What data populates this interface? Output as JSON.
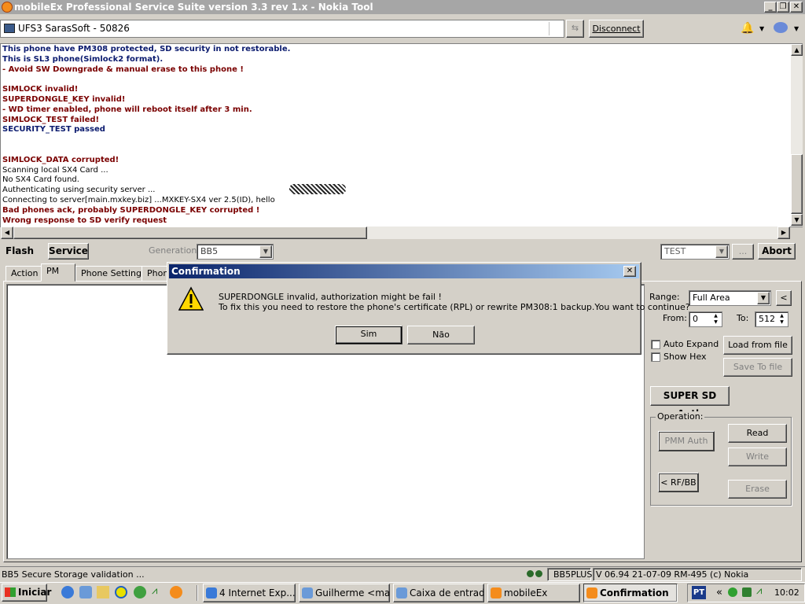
{
  "window": {
    "title": "mobileEx Professional Service Suite version 3.3 rev 1.x  - Nokia Tool",
    "min": "_",
    "max": "❐",
    "close": "✕"
  },
  "toolbar": {
    "device": "UFS3 SarasSoft - 50826",
    "disconnect": "Disconnect"
  },
  "log": [
    {
      "text": "This phone have PM308 protected, SD security in not restorable.",
      "style": "navy"
    },
    {
      "text": "This is SL3 phone(Simlock2 format).",
      "style": "navy"
    },
    {
      "text": "- Avoid SW Downgrade & manual erase to this phone !",
      "style": "red"
    },
    {
      "text": "",
      "style": "blk"
    },
    {
      "text": "SIMLOCK invalid!",
      "style": "red"
    },
    {
      "text": "SUPERDONGLE_KEY invalid!",
      "style": "red"
    },
    {
      "text": "- WD timer enabled, phone will reboot itself after 3 min.",
      "style": "red"
    },
    {
      "text": "SIMLOCK_TEST failed!",
      "style": "red"
    },
    {
      "text": "SECURITY_TEST passed",
      "style": "navy"
    },
    {
      "text": "",
      "style": "blk"
    },
    {
      "text": "",
      "style": "blk"
    },
    {
      "text": "SIMLOCK_DATA corrupted!",
      "style": "red"
    },
    {
      "text": "Scanning local SX4 Card ...",
      "style": "blk"
    },
    {
      "text": "No SX4 Card found.",
      "style": "blk"
    },
    {
      "text": "Authenticating using security server ...",
      "style": "blk"
    },
    {
      "text": "Connecting to server[main.mxkey.biz] ...MXKEY-SX4 ver 2.5(ID),  hello ",
      "style": "blk"
    },
    {
      "text": "Bad phones ack, probably SUPERDONGLE_KEY corrupted !",
      "style": "red"
    },
    {
      "text": "Wrong response to SD verify request",
      "style": "red"
    }
  ],
  "mode_tabs": {
    "flash": "Flash",
    "service": "Service"
  },
  "generation": {
    "label": "Generation:",
    "value": "BB5"
  },
  "test_combo": {
    "value": "TEST",
    "ellipsis": "...",
    "abort": "Abort"
  },
  "tabs": {
    "action": "Action",
    "pm": "PM",
    "phone_settings": "Phone Settings",
    "phone": "Phone"
  },
  "right_panel": {
    "range_label": "Range:",
    "range_value": "Full Area",
    "range_btn": "<",
    "from_label": "From:",
    "from_value": "0",
    "to_label": "To:",
    "to_value": "512",
    "auto_expand": "Auto Expand",
    "show_hex": "Show Hex",
    "load": "Load from file",
    "save": "Save To file",
    "super_sd": "SUPER SD Auth",
    "operation": "Operation:",
    "pmm_auth": "PMM Auth",
    "read": "Read",
    "write": "Write",
    "rf_bb": "< RF/BB",
    "erase": "Erase"
  },
  "dialog": {
    "title": "Confirmation",
    "line1": "SUPERDONGLE invalid, authorization might be fail !",
    "line2": "To fix this you need to restore the phone's certificate (RPL) or rewrite PM308:1 backup.You want to continue?",
    "yes": "Sim",
    "no": "Não",
    "close": "✕"
  },
  "statusbar": {
    "message": "BB5 Secure Storage validation ...",
    "model": "BB5PLUS",
    "version": "V 06.94 21-07-09 RM-495 (c) Nokia"
  },
  "taskbar": {
    "start": "Iniciar",
    "items": [
      "4 Internet Exp...",
      "Guilherme <mag...",
      "Caixa de entrad...",
      "mobileEx",
      "Confirmation"
    ],
    "lang": "PT",
    "chevron": "«",
    "clock": "10:02"
  }
}
